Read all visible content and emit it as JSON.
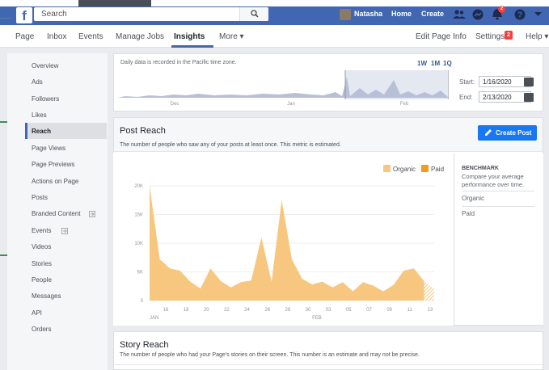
{
  "topbar": {
    "logo": "f",
    "search_placeholder": "Search",
    "search_icon": "magnifier-icon",
    "user": "Natasha",
    "home": "Home",
    "create": "Create",
    "notifications_count": "2",
    "colors": {
      "bar": "#4267b2",
      "badge": "#fa3e3e"
    }
  },
  "pagenav": {
    "items": [
      "Page",
      "Inbox",
      "Events",
      "Manage Jobs",
      "Insights",
      "More ▾"
    ],
    "active": "Insights",
    "edit_page_info": "Edit Page Info",
    "settings": "Settings",
    "settings_badge": "2",
    "help": "Help ▾"
  },
  "sidebar": {
    "items": [
      "Overview",
      "Ads",
      "Followers",
      "Likes",
      "Reach",
      "Page Views",
      "Page Previews",
      "Actions on Page",
      "Posts",
      "Branded Content",
      "Events",
      "Videos",
      "Stories",
      "People",
      "Messages",
      "API",
      "Orders"
    ],
    "active": "Reach"
  },
  "range_panel": {
    "note": "Daily data is recorded in the Pacific time zone.",
    "ranges": [
      "1W",
      "1M",
      "1Q"
    ],
    "months": [
      "Dec",
      "Jan",
      "Feb"
    ],
    "start_label": "Start:",
    "start_value": "1/16/2020",
    "end_label": "End:",
    "end_value": "2/13/2020"
  },
  "post_reach": {
    "title": "Post Reach",
    "desc": "The number of people who saw any of your posts at least once. This metric is estimated.",
    "create_post": "Create Post"
  },
  "benchmark": {
    "title": "BENCHMARK",
    "desc": "Compare your average performance over time.",
    "organic": "Organic",
    "paid": "Paid"
  },
  "chart_data": {
    "type": "area",
    "legend": [
      "Organic",
      "Paid"
    ],
    "legend_placement": "top-right",
    "colors": {
      "Organic": "#f7c77f",
      "Paid": "#f29b1c"
    },
    "yticks": [
      "20K",
      "15K",
      "10K",
      "5K",
      "0"
    ],
    "ylim": [
      0,
      20000
    ],
    "xticks": [
      "16",
      "18",
      "20",
      "22",
      "24",
      "26",
      "28",
      "30",
      "03",
      "05",
      "07",
      "09",
      "11",
      "13"
    ],
    "xmonth_labels": [
      "JAN",
      "FEB"
    ],
    "x": [
      "Jan 16",
      "Jan 17",
      "Jan 18",
      "Jan 19",
      "Jan 20",
      "Jan 21",
      "Jan 22",
      "Jan 23",
      "Jan 24",
      "Jan 25",
      "Jan 26",
      "Jan 27",
      "Jan 28",
      "Jan 29",
      "Jan 30",
      "Jan 31",
      "Feb 1",
      "Feb 2",
      "Feb 3",
      "Feb 4",
      "Feb 5",
      "Feb 6",
      "Feb 7",
      "Feb 8",
      "Feb 9",
      "Feb 10",
      "Feb 11",
      "Feb 12",
      "Feb 13"
    ],
    "series": [
      {
        "name": "Organic",
        "values": [
          20000,
          7200,
          5600,
          5200,
          3300,
          2100,
          5600,
          3400,
          2300,
          3200,
          3500,
          11000,
          3300,
          17500,
          7200,
          3800,
          2800,
          3300,
          2300,
          3200,
          1600,
          3200,
          2600,
          1600,
          2700,
          5200,
          5600,
          3400,
          2000
        ]
      },
      {
        "name": "Paid",
        "values": [
          0,
          0,
          0,
          0,
          0,
          0,
          0,
          0,
          0,
          0,
          0,
          0,
          0,
          0,
          0,
          0,
          0,
          0,
          0,
          0,
          0,
          0,
          0,
          0,
          0,
          0,
          0,
          0,
          0
        ]
      }
    ]
  },
  "story_reach": {
    "title": "Story Reach",
    "desc": "The number of people who had your Page's stories on their screen. This number is an estimate and may not be precise."
  }
}
